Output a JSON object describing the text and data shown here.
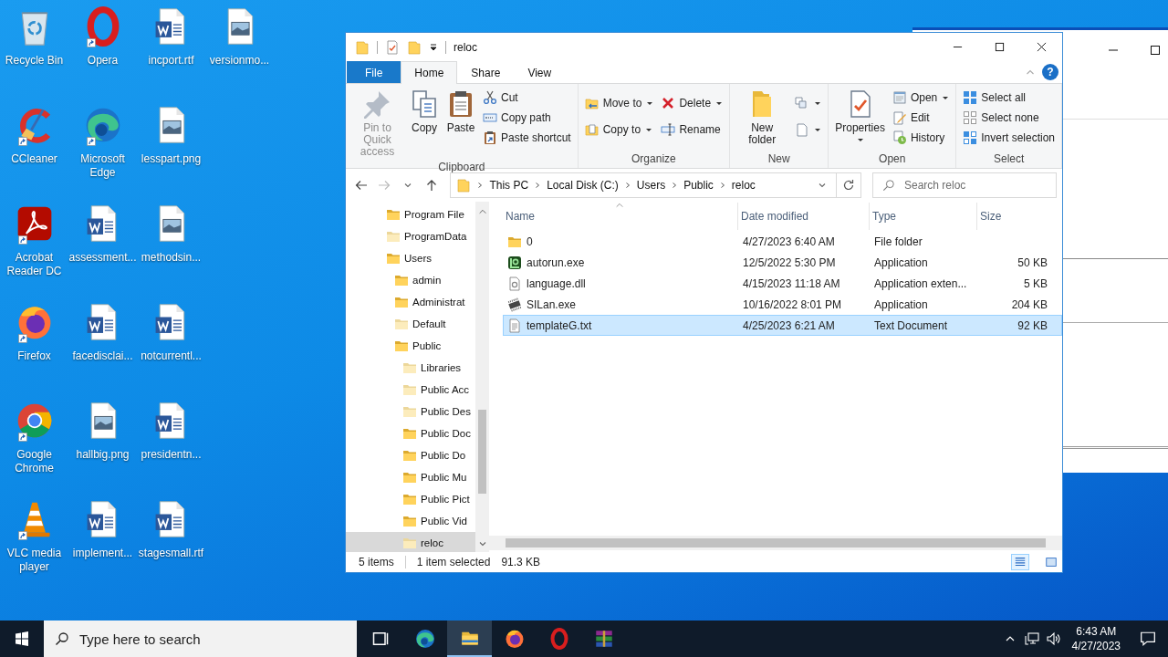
{
  "desktop": {
    "icons": [
      {
        "label": "Recycle Bin",
        "kind": "recycle",
        "shortcut": false
      },
      {
        "label": "CCleaner",
        "kind": "ccleaner",
        "shortcut": true
      },
      {
        "label": "Acrobat Reader DC",
        "kind": "acrobat",
        "shortcut": true
      },
      {
        "label": "Firefox",
        "kind": "firefox",
        "shortcut": true
      },
      {
        "label": "Google Chrome",
        "kind": "chrome",
        "shortcut": true
      },
      {
        "label": "VLC media player",
        "kind": "vlc",
        "shortcut": true
      },
      {
        "label": "Opera",
        "kind": "opera",
        "shortcut": true
      },
      {
        "label": "Microsoft Edge",
        "kind": "edge",
        "shortcut": true
      },
      {
        "label": "assessment...",
        "kind": "word",
        "shortcut": false
      },
      {
        "label": "facedisclai...",
        "kind": "word",
        "shortcut": false
      },
      {
        "label": "hallbig.png",
        "kind": "image",
        "shortcut": false
      },
      {
        "label": "implement...",
        "kind": "word",
        "shortcut": false
      },
      {
        "label": "incport.rtf",
        "kind": "word",
        "shortcut": false
      },
      {
        "label": "lesspart.png",
        "kind": "image",
        "shortcut": false
      },
      {
        "label": "methodsin...",
        "kind": "image",
        "shortcut": false
      },
      {
        "label": "notcurrentl...",
        "kind": "word",
        "shortcut": false
      },
      {
        "label": "presidentn...",
        "kind": "word",
        "shortcut": false
      },
      {
        "label": "stagesmall.rtf",
        "kind": "word",
        "shortcut": false
      },
      {
        "label": "versionmo...",
        "kind": "image",
        "shortcut": false
      }
    ]
  },
  "explorer": {
    "title": "reloc",
    "ribbon_tabs": [
      {
        "label": "File",
        "kind": "file",
        "selected": false
      },
      {
        "label": "Home",
        "kind": "tab",
        "selected": true
      },
      {
        "label": "Share",
        "kind": "tab",
        "selected": false
      },
      {
        "label": "View",
        "kind": "tab",
        "selected": false
      }
    ],
    "help": "?",
    "ribbon_groups": [
      {
        "label": "Clipboard",
        "controls": [
          {
            "kind": "large",
            "label": "Pin to Quick access",
            "dropdown": false,
            "disabled": true
          },
          {
            "kind": "large",
            "label": "Copy",
            "dropdown": false,
            "disabled": false
          },
          {
            "kind": "large",
            "label": "Paste",
            "dropdown": false,
            "disabled": false
          },
          {
            "kind": "stack",
            "items": [
              {
                "label": "Cut",
                "dropdown": false,
                "disabled": false
              },
              {
                "label": "Copy path",
                "dropdown": false,
                "disabled": false
              },
              {
                "label": "Paste shortcut",
                "dropdown": false,
                "disabled": false
              }
            ]
          }
        ]
      },
      {
        "label": "Organize",
        "controls": [
          {
            "kind": "stack",
            "items": [
              {
                "label": "Move to",
                "dropdown": true,
                "disabled": false
              },
              {
                "label": "Copy to",
                "dropdown": true,
                "disabled": false
              }
            ]
          },
          {
            "kind": "stack",
            "items": [
              {
                "label": "Delete",
                "dropdown": true,
                "disabled": false
              },
              {
                "label": "Rename",
                "dropdown": false,
                "disabled": false
              }
            ]
          }
        ]
      },
      {
        "label": "New",
        "controls": [
          {
            "kind": "large",
            "label": "New folder",
            "dropdown": false,
            "disabled": false
          },
          {
            "kind": "stack",
            "items": [
              {
                "dropdown": true,
                "disabled": false
              },
              {
                "dropdown": true,
                "disabled": false
              }
            ]
          }
        ]
      },
      {
        "label": "Open",
        "controls": [
          {
            "kind": "large",
            "label": "Properties",
            "dropdown": true,
            "disabled": false
          },
          {
            "kind": "stack",
            "items": [
              {
                "label": "Open",
                "dropdown": true,
                "disabled": false
              },
              {
                "label": "Edit",
                "dropdown": false,
                "disabled": false
              },
              {
                "label": "History",
                "dropdown": false,
                "disabled": false
              }
            ]
          }
        ]
      },
      {
        "label": "Select",
        "controls": [
          {
            "kind": "stack",
            "items": [
              {
                "label": "Select all",
                "dropdown": false,
                "disabled": false
              },
              {
                "label": "Select none",
                "dropdown": false,
                "disabled": false
              },
              {
                "label": "Invert selection",
                "dropdown": false,
                "disabled": false
              }
            ]
          }
        ]
      }
    ],
    "address": {
      "path": [
        "This PC",
        "Local Disk (C:)",
        "Users",
        "Public",
        "reloc"
      ],
      "search_placeholder": "Search reloc"
    },
    "navigation": [
      {
        "label": "Program File",
        "hidden": false,
        "selected": false
      },
      {
        "label": "ProgramData",
        "hidden": true,
        "selected": false
      },
      {
        "label": "Users",
        "hidden": false,
        "selected": false,
        "children": [
          {
            "label": "admin",
            "hidden": false,
            "selected": false
          },
          {
            "label": "Administrat",
            "hidden": false,
            "selected": false
          },
          {
            "label": "Default",
            "hidden": true,
            "selected": false
          },
          {
            "label": "Public",
            "hidden": false,
            "selected": false,
            "children": [
              {
                "label": "Libraries",
                "hidden": true,
                "selected": false
              },
              {
                "label": "Public Acc",
                "hidden": true,
                "selected": false
              },
              {
                "label": "Public Des",
                "hidden": true,
                "selected": false
              },
              {
                "label": "Public Doc",
                "hidden": false,
                "selected": false
              },
              {
                "label": "Public Do",
                "hidden": false,
                "selected": false
              },
              {
                "label": "Public Mu",
                "hidden": false,
                "selected": false
              },
              {
                "label": "Public Pict",
                "hidden": false,
                "selected": false
              },
              {
                "label": "Public Vid",
                "hidden": false,
                "selected": false
              },
              {
                "label": "reloc",
                "hidden": true,
                "selected": true
              }
            ]
          }
        ]
      }
    ],
    "columns": [
      "Name",
      "Date modified",
      "Type",
      "Size"
    ],
    "files": [
      {
        "name": "0",
        "date": "4/27/2023 6:40 AM",
        "type": "File folder",
        "kind": "folder",
        "selected": false
      },
      {
        "name": "autorun.exe",
        "date": "12/5/2022 5:30 PM",
        "type": "Application",
        "size": "50 KB",
        "kind": "app",
        "selected": false
      },
      {
        "name": "language.dll",
        "date": "4/15/2023 11:18 AM",
        "type": "Application exten...",
        "size": "5 KB",
        "kind": "dll",
        "selected": false
      },
      {
        "name": "SILan.exe",
        "date": "10/16/2022 8:01 PM",
        "type": "Application",
        "size": "204 KB",
        "kind": "chip",
        "selected": false
      },
      {
        "name": "templateG.txt",
        "date": "4/25/2023 6:21 AM",
        "type": "Text Document",
        "size": "92 KB",
        "kind": "text",
        "selected": true
      }
    ],
    "status": {
      "item_count": "5 items",
      "selection": "1 item selected",
      "selection_size": "91.3 KB"
    },
    "view_buttons": [
      {
        "kind": "details",
        "selected": true
      },
      {
        "kind": "large-icons",
        "selected": false
      }
    ]
  },
  "taskbar": {
    "search_placeholder": "Type here to search",
    "apps": [
      {
        "kind": "taskview",
        "active": false
      },
      {
        "kind": "edge",
        "active": false
      },
      {
        "kind": "explorer",
        "active": true
      },
      {
        "kind": "firefox",
        "active": false
      },
      {
        "kind": "opera",
        "active": false
      },
      {
        "kind": "winrar",
        "active": false
      }
    ],
    "time": "6:43 AM",
    "date": "4/27/2023"
  }
}
